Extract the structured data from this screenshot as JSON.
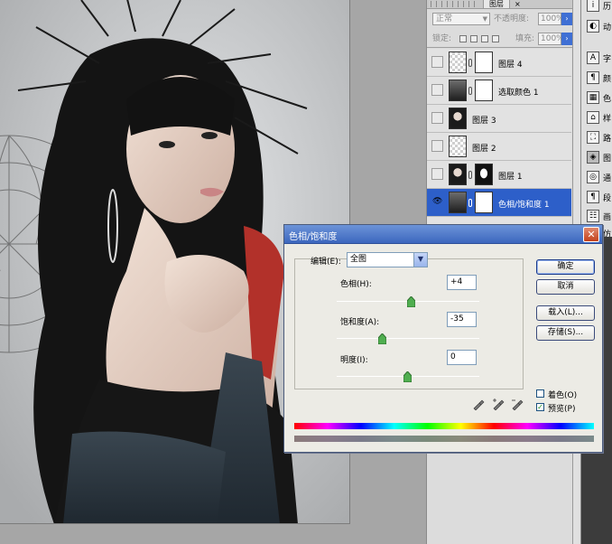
{
  "layers_panel": {
    "tab_label": "图层",
    "tab_close": "×",
    "blend_mode": "正常",
    "opacity_label": "不透明度:",
    "opacity_value": "100%",
    "lock_label": "锁定:",
    "fill_label": "填充:",
    "fill_value": "100%",
    "layers": [
      {
        "name": "图层 4",
        "selected": false
      },
      {
        "name": "选取颜色 1",
        "selected": false
      },
      {
        "name": "图层 3",
        "selected": false
      },
      {
        "name": "图层 2",
        "selected": false
      },
      {
        "name": "图层 1",
        "selected": false
      },
      {
        "name": "色相/饱和度 1",
        "selected": true
      }
    ]
  },
  "dock": {
    "items": [
      {
        "glyph": "i",
        "label": "历"
      },
      {
        "glyph": "◐",
        "label": "动"
      },
      {
        "glyph": "A",
        "label": "字"
      },
      {
        "glyph": "¶",
        "label": "颜"
      },
      {
        "glyph": "▦",
        "label": "色"
      },
      {
        "glyph": "⌂",
        "label": "样"
      },
      {
        "glyph": "⛶",
        "label": "路"
      },
      {
        "glyph": "◈",
        "label": "图"
      },
      {
        "glyph": "◎",
        "label": "通"
      },
      {
        "glyph": "¶",
        "label": "段"
      },
      {
        "glyph": "☷",
        "label": "画"
      },
      {
        "glyph": "⊕",
        "label": "仿"
      }
    ]
  },
  "dialog": {
    "title": "色相/饱和度",
    "close_glyph": "✕",
    "edit_label": "编辑(E):",
    "edit_value": "全图",
    "hue_label": "色相(H):",
    "hue_value": "+4",
    "saturation_label": "饱和度(A):",
    "saturation_value": "-35",
    "lightness_label": "明度(I):",
    "lightness_value": "0",
    "ok_label": "确定",
    "cancel_label": "取消",
    "load_label": "载入(L)...",
    "save_label": "存储(S)...",
    "colorize_label": "着色(O)",
    "colorize_checked": false,
    "preview_label": "预览(P)",
    "preview_checked": true
  }
}
